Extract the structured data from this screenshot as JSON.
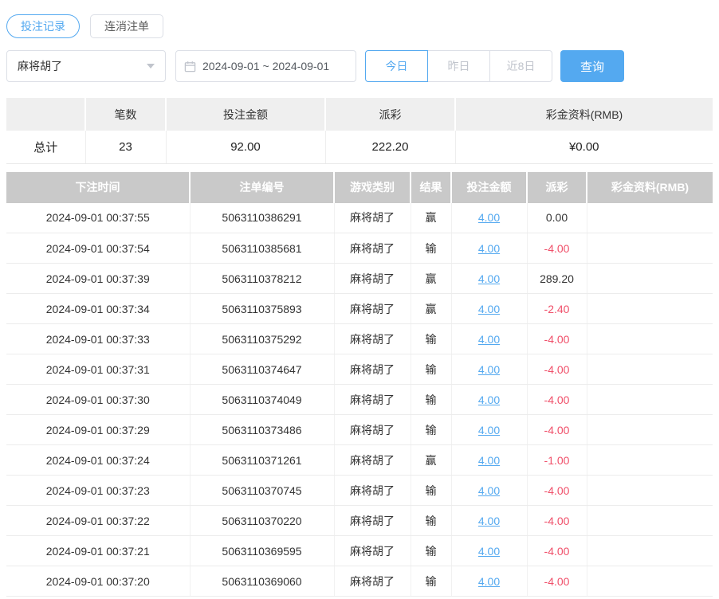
{
  "tabs": [
    {
      "label": "投注记录",
      "active": true
    },
    {
      "label": "连消注单",
      "active": false
    }
  ],
  "filters": {
    "game_select": {
      "value": "麻将胡了"
    },
    "date_range": "2024-09-01 ~ 2024-09-01",
    "quick_buttons": [
      {
        "label": "今日",
        "active": true
      },
      {
        "label": "昨日",
        "active": false
      },
      {
        "label": "近8日",
        "active": false
      }
    ],
    "search_label": "查询"
  },
  "icons": {
    "calendar": "calendar-icon",
    "select_caret": "chevron-down-icon"
  },
  "summary": {
    "headers": [
      "",
      "笔数",
      "投注金额",
      "派彩",
      "彩金资料(RMB)"
    ],
    "row": {
      "label": "总计",
      "count": "23",
      "bet_amount": "92.00",
      "payout": "222.20",
      "bonus": "¥0.00"
    }
  },
  "table": {
    "headers": [
      "下注时间",
      "注单编号",
      "游戏类别",
      "结果",
      "投注金额",
      "派彩",
      "彩金资料(RMB)"
    ],
    "rows": [
      {
        "time": "2024-09-01 00:37:55",
        "order_id": "5063110386291",
        "game": "麻将胡了",
        "result": "赢",
        "bet": "4.00",
        "payout": "0.00",
        "bonus": ""
      },
      {
        "time": "2024-09-01 00:37:54",
        "order_id": "5063110385681",
        "game": "麻将胡了",
        "result": "输",
        "bet": "4.00",
        "payout": "-4.00",
        "bonus": ""
      },
      {
        "time": "2024-09-01 00:37:39",
        "order_id": "5063110378212",
        "game": "麻将胡了",
        "result": "赢",
        "bet": "4.00",
        "payout": "289.20",
        "bonus": ""
      },
      {
        "time": "2024-09-01 00:37:34",
        "order_id": "5063110375893",
        "game": "麻将胡了",
        "result": "赢",
        "bet": "4.00",
        "payout": "-2.40",
        "bonus": ""
      },
      {
        "time": "2024-09-01 00:37:33",
        "order_id": "5063110375292",
        "game": "麻将胡了",
        "result": "输",
        "bet": "4.00",
        "payout": "-4.00",
        "bonus": ""
      },
      {
        "time": "2024-09-01 00:37:31",
        "order_id": "5063110374647",
        "game": "麻将胡了",
        "result": "输",
        "bet": "4.00",
        "payout": "-4.00",
        "bonus": ""
      },
      {
        "time": "2024-09-01 00:37:30",
        "order_id": "5063110374049",
        "game": "麻将胡了",
        "result": "输",
        "bet": "4.00",
        "payout": "-4.00",
        "bonus": ""
      },
      {
        "time": "2024-09-01 00:37:29",
        "order_id": "5063110373486",
        "game": "麻将胡了",
        "result": "输",
        "bet": "4.00",
        "payout": "-4.00",
        "bonus": ""
      },
      {
        "time": "2024-09-01 00:37:24",
        "order_id": "5063110371261",
        "game": "麻将胡了",
        "result": "赢",
        "bet": "4.00",
        "payout": "-1.00",
        "bonus": ""
      },
      {
        "time": "2024-09-01 00:37:23",
        "order_id": "5063110370745",
        "game": "麻将胡了",
        "result": "输",
        "bet": "4.00",
        "payout": "-4.00",
        "bonus": ""
      },
      {
        "time": "2024-09-01 00:37:22",
        "order_id": "5063110370220",
        "game": "麻将胡了",
        "result": "输",
        "bet": "4.00",
        "payout": "-4.00",
        "bonus": ""
      },
      {
        "time": "2024-09-01 00:37:21",
        "order_id": "5063110369595",
        "game": "麻将胡了",
        "result": "输",
        "bet": "4.00",
        "payout": "-4.00",
        "bonus": ""
      },
      {
        "time": "2024-09-01 00:37:20",
        "order_id": "5063110369060",
        "game": "麻将胡了",
        "result": "输",
        "bet": "4.00",
        "payout": "-4.00",
        "bonus": ""
      }
    ]
  },
  "colors": {
    "accent_blue": "#54a9f0",
    "negative_red": "#f0506a",
    "table_header_gray": "#c9c9c9",
    "summary_header_gray": "#efefef",
    "muted_gray": "#c0c4cc"
  }
}
